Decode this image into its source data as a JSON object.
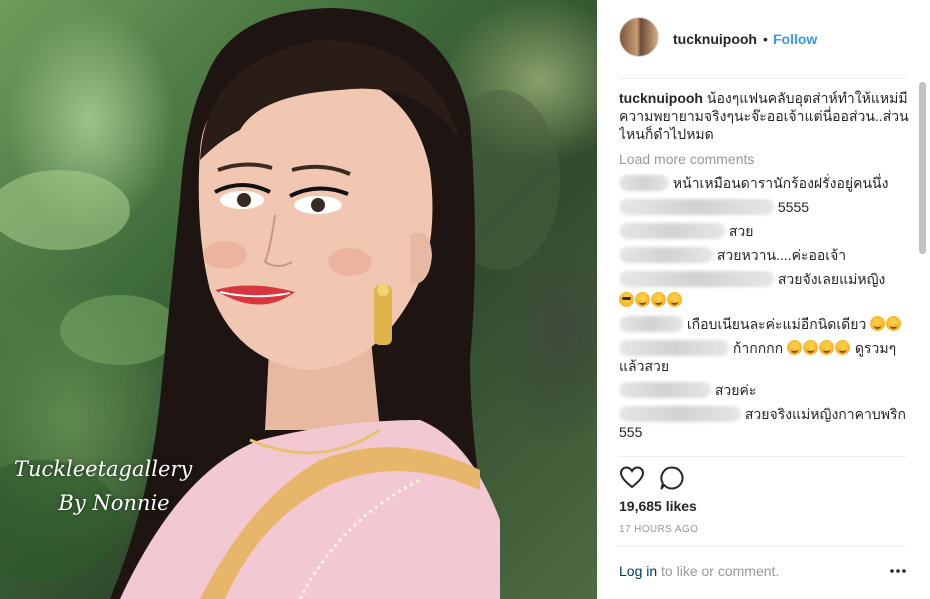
{
  "photo": {
    "watermark_line1": "Tuckleetagallery",
    "watermark_line2": "By Nonnie"
  },
  "header": {
    "username": "tucknuipooh",
    "separator": "•",
    "follow_label": "Follow"
  },
  "caption": {
    "username": "tucknuipooh",
    "text": "น้องๆแฟนคลับอุตส่าห์ทำให้แหม่มีความพยายามจริงๆนะจ๊ะออเจ้าแต่นี่ออส่วน..ส่วนไหนก็ดำไปหมด"
  },
  "load_more_label": "Load more comments",
  "comments": [
    {
      "text": "หน้าเหมือนดารานักร้องฝรั่งอยู่คนนึ่ง"
    },
    {
      "text": "5555"
    },
    {
      "text": "สวย"
    },
    {
      "text": "สวยหวาน....ค่ะออเจ้า"
    },
    {
      "text": "สวยจังเลยแม่หญิง"
    },
    {
      "text": "เกือบเนียนละค่ะแม่อีกนิดเดียว"
    },
    {
      "text": "ก้ากกกก"
    },
    {
      "text": "ดูรวมๆแล้วสวย"
    },
    {
      "text": "สวยค่ะ"
    },
    {
      "text": "สวยจริงแม่หญิงกาคาบพริก 555"
    }
  ],
  "likes_label": "19,685 likes",
  "time_label": "17 HOURS AGO",
  "login": {
    "link_label": "Log in",
    "suffix": " to like or comment."
  },
  "icons": [
    "heart-icon",
    "comment-icon",
    "more-options-icon"
  ],
  "colors": {
    "link_blue": "#3897f0",
    "text": "#262626",
    "muted": "#999999",
    "login_link": "#003569"
  }
}
